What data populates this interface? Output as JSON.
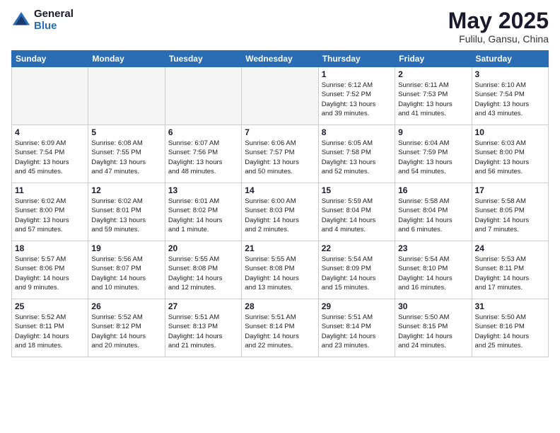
{
  "header": {
    "logo_general": "General",
    "logo_blue": "Blue",
    "month": "May 2025",
    "location": "Fulilu, Gansu, China"
  },
  "days_of_week": [
    "Sunday",
    "Monday",
    "Tuesday",
    "Wednesday",
    "Thursday",
    "Friday",
    "Saturday"
  ],
  "weeks": [
    [
      {
        "day": "",
        "detail": ""
      },
      {
        "day": "",
        "detail": ""
      },
      {
        "day": "",
        "detail": ""
      },
      {
        "day": "",
        "detail": ""
      },
      {
        "day": "1",
        "detail": "Sunrise: 6:12 AM\nSunset: 7:52 PM\nDaylight: 13 hours\nand 39 minutes."
      },
      {
        "day": "2",
        "detail": "Sunrise: 6:11 AM\nSunset: 7:53 PM\nDaylight: 13 hours\nand 41 minutes."
      },
      {
        "day": "3",
        "detail": "Sunrise: 6:10 AM\nSunset: 7:54 PM\nDaylight: 13 hours\nand 43 minutes."
      }
    ],
    [
      {
        "day": "4",
        "detail": "Sunrise: 6:09 AM\nSunset: 7:54 PM\nDaylight: 13 hours\nand 45 minutes."
      },
      {
        "day": "5",
        "detail": "Sunrise: 6:08 AM\nSunset: 7:55 PM\nDaylight: 13 hours\nand 47 minutes."
      },
      {
        "day": "6",
        "detail": "Sunrise: 6:07 AM\nSunset: 7:56 PM\nDaylight: 13 hours\nand 48 minutes."
      },
      {
        "day": "7",
        "detail": "Sunrise: 6:06 AM\nSunset: 7:57 PM\nDaylight: 13 hours\nand 50 minutes."
      },
      {
        "day": "8",
        "detail": "Sunrise: 6:05 AM\nSunset: 7:58 PM\nDaylight: 13 hours\nand 52 minutes."
      },
      {
        "day": "9",
        "detail": "Sunrise: 6:04 AM\nSunset: 7:59 PM\nDaylight: 13 hours\nand 54 minutes."
      },
      {
        "day": "10",
        "detail": "Sunrise: 6:03 AM\nSunset: 8:00 PM\nDaylight: 13 hours\nand 56 minutes."
      }
    ],
    [
      {
        "day": "11",
        "detail": "Sunrise: 6:02 AM\nSunset: 8:00 PM\nDaylight: 13 hours\nand 57 minutes."
      },
      {
        "day": "12",
        "detail": "Sunrise: 6:02 AM\nSunset: 8:01 PM\nDaylight: 13 hours\nand 59 minutes."
      },
      {
        "day": "13",
        "detail": "Sunrise: 6:01 AM\nSunset: 8:02 PM\nDaylight: 14 hours\nand 1 minute."
      },
      {
        "day": "14",
        "detail": "Sunrise: 6:00 AM\nSunset: 8:03 PM\nDaylight: 14 hours\nand 2 minutes."
      },
      {
        "day": "15",
        "detail": "Sunrise: 5:59 AM\nSunset: 8:04 PM\nDaylight: 14 hours\nand 4 minutes."
      },
      {
        "day": "16",
        "detail": "Sunrise: 5:58 AM\nSunset: 8:04 PM\nDaylight: 14 hours\nand 6 minutes."
      },
      {
        "day": "17",
        "detail": "Sunrise: 5:58 AM\nSunset: 8:05 PM\nDaylight: 14 hours\nand 7 minutes."
      }
    ],
    [
      {
        "day": "18",
        "detail": "Sunrise: 5:57 AM\nSunset: 8:06 PM\nDaylight: 14 hours\nand 9 minutes."
      },
      {
        "day": "19",
        "detail": "Sunrise: 5:56 AM\nSunset: 8:07 PM\nDaylight: 14 hours\nand 10 minutes."
      },
      {
        "day": "20",
        "detail": "Sunrise: 5:55 AM\nSunset: 8:08 PM\nDaylight: 14 hours\nand 12 minutes."
      },
      {
        "day": "21",
        "detail": "Sunrise: 5:55 AM\nSunset: 8:08 PM\nDaylight: 14 hours\nand 13 minutes."
      },
      {
        "day": "22",
        "detail": "Sunrise: 5:54 AM\nSunset: 8:09 PM\nDaylight: 14 hours\nand 15 minutes."
      },
      {
        "day": "23",
        "detail": "Sunrise: 5:54 AM\nSunset: 8:10 PM\nDaylight: 14 hours\nand 16 minutes."
      },
      {
        "day": "24",
        "detail": "Sunrise: 5:53 AM\nSunset: 8:11 PM\nDaylight: 14 hours\nand 17 minutes."
      }
    ],
    [
      {
        "day": "25",
        "detail": "Sunrise: 5:52 AM\nSunset: 8:11 PM\nDaylight: 14 hours\nand 18 minutes."
      },
      {
        "day": "26",
        "detail": "Sunrise: 5:52 AM\nSunset: 8:12 PM\nDaylight: 14 hours\nand 20 minutes."
      },
      {
        "day": "27",
        "detail": "Sunrise: 5:51 AM\nSunset: 8:13 PM\nDaylight: 14 hours\nand 21 minutes."
      },
      {
        "day": "28",
        "detail": "Sunrise: 5:51 AM\nSunset: 8:14 PM\nDaylight: 14 hours\nand 22 minutes."
      },
      {
        "day": "29",
        "detail": "Sunrise: 5:51 AM\nSunset: 8:14 PM\nDaylight: 14 hours\nand 23 minutes."
      },
      {
        "day": "30",
        "detail": "Sunrise: 5:50 AM\nSunset: 8:15 PM\nDaylight: 14 hours\nand 24 minutes."
      },
      {
        "day": "31",
        "detail": "Sunrise: 5:50 AM\nSunset: 8:16 PM\nDaylight: 14 hours\nand 25 minutes."
      }
    ]
  ]
}
